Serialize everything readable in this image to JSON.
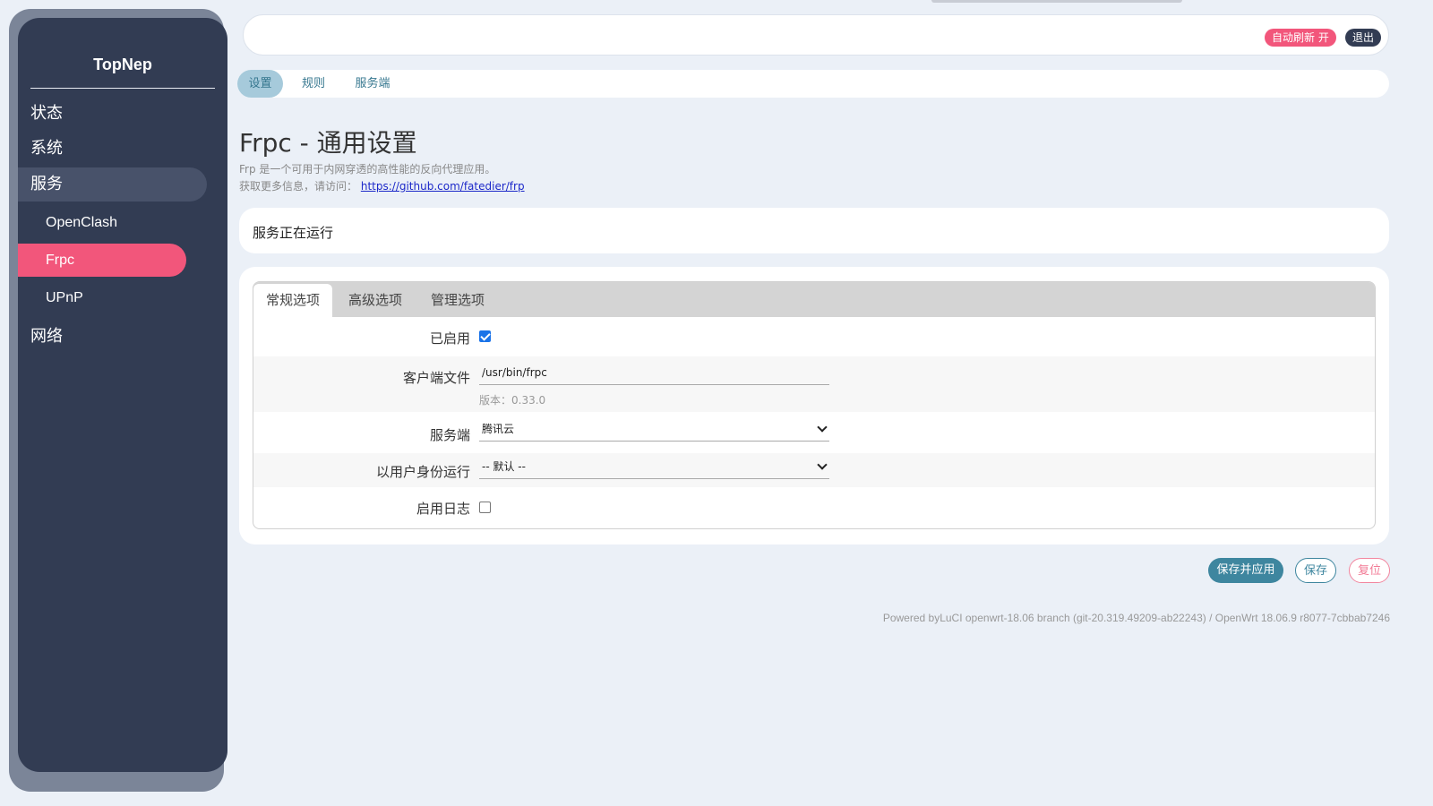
{
  "sidebar": {
    "brand": "TopNep",
    "items": [
      {
        "label": "状态"
      },
      {
        "label": "系统"
      },
      {
        "label": "服务"
      },
      {
        "label": "网络"
      }
    ],
    "sub_items": [
      {
        "label": "OpenClash"
      },
      {
        "label": "Frpc"
      },
      {
        "label": "UPnP"
      }
    ]
  },
  "header": {
    "auto_refresh_label": "自动刷新 开",
    "logout_label": "退出"
  },
  "subtabs": [
    {
      "label": "设置"
    },
    {
      "label": "规则"
    },
    {
      "label": "服务端"
    }
  ],
  "page": {
    "title": "Frpc - 通用设置",
    "desc_line1": "Frp 是一个可用于内网穿透的高性能的反向代理应用。",
    "desc_line2_prefix": "获取更多信息，请访问：",
    "desc_link": "https://github.com/fatedier/frp"
  },
  "status": {
    "text": "服务正在运行"
  },
  "tabs": [
    {
      "label": "常规选项"
    },
    {
      "label": "高级选项"
    },
    {
      "label": "管理选项"
    }
  ],
  "form": {
    "enabled": {
      "label": "已启用",
      "checked": true
    },
    "client_file": {
      "label": "客户端文件",
      "value": "/usr/bin/frpc",
      "hint": "版本：0.33.0"
    },
    "server": {
      "label": "服务端",
      "value": "腾讯云"
    },
    "run_as": {
      "label": "以用户身份运行",
      "value": "-- 默认 --"
    },
    "enable_log": {
      "label": "启用日志",
      "checked": false
    }
  },
  "actions": {
    "save_apply": "保存并应用",
    "save": "保存",
    "reset": "复位"
  },
  "footer": {
    "text": "Powered byLuCI openwrt-18.06 branch (git-20.319.49209-ab22243) / OpenWrt 18.06.9 r8077-7cbbab7246"
  }
}
